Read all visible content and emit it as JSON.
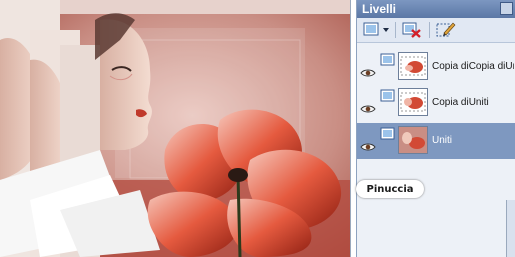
{
  "panel": {
    "title": "Livelli"
  },
  "toolbar": {
    "new_layer_icon": "new-raster-layer-icon",
    "delete_layer_icon": "delete-layer-icon",
    "edit_icon": "edit-selection-icon"
  },
  "layers": [
    {
      "name": "Copia diCopia diUniti",
      "visible": true,
      "selected": false
    },
    {
      "name": "Copia diUniti",
      "visible": true,
      "selected": false
    },
    {
      "name": "Uniti",
      "visible": true,
      "selected": true
    }
  ],
  "watermark": "Pinuccia",
  "colors": {
    "panel_header": "#6b86b2",
    "selected_row": "#7e98c0",
    "artwork_red": "#c0392b"
  }
}
